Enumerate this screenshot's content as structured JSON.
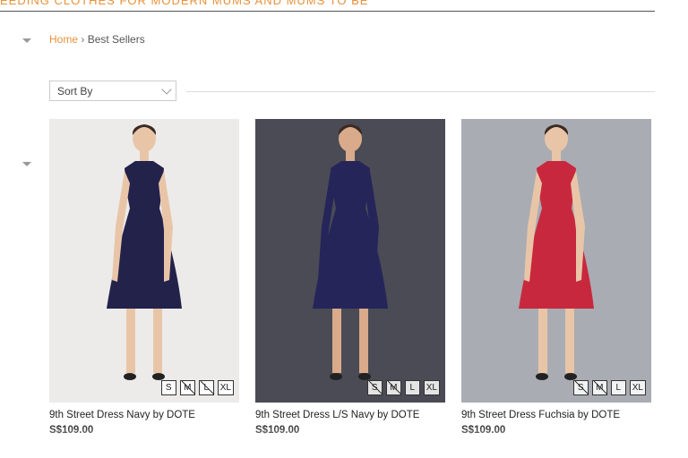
{
  "banner": {
    "text": "EEDING CLOTHES FOR MODERN MUMS AND MUMS TO BE"
  },
  "breadcrumb": {
    "home": "Home",
    "separator": "›",
    "current": "Best Sellers"
  },
  "sort": {
    "label": "Sort By"
  },
  "products": [
    {
      "name": "9th Street Dress Navy by DOTE",
      "price": "S$109.00",
      "dress_color": "#23224a",
      "background": "#ecebea",
      "sizes": [
        {
          "label": "S",
          "available": true
        },
        {
          "label": "M",
          "available": false
        },
        {
          "label": "L",
          "available": false
        },
        {
          "label": "XL",
          "available": true
        }
      ]
    },
    {
      "name": "9th Street Dress L/S Navy by DOTE",
      "price": "S$109.00",
      "dress_color": "#26255a",
      "background": "#4a4b55",
      "sizes": [
        {
          "label": "S",
          "available": false
        },
        {
          "label": "M",
          "available": false
        },
        {
          "label": "L",
          "available": true
        },
        {
          "label": "XL",
          "available": true
        }
      ]
    },
    {
      "name": "9th Street Dress Fuchsia by DOTE",
      "price": "S$109.00",
      "dress_color": "#c8283d",
      "background": "#a9acb3",
      "sizes": [
        {
          "label": "S",
          "available": false
        },
        {
          "label": "M",
          "available": false
        },
        {
          "label": "L",
          "available": true
        },
        {
          "label": "XL",
          "available": true
        }
      ]
    }
  ]
}
